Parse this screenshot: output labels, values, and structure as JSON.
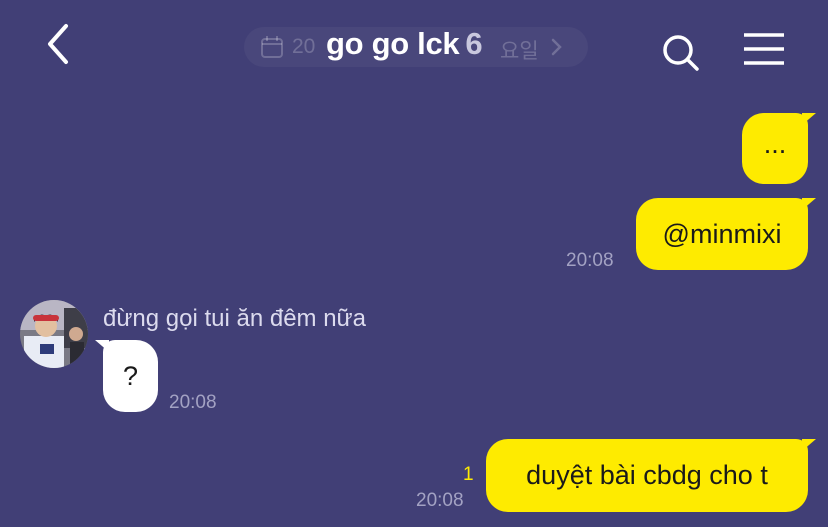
{
  "header": {
    "chat_title": "go go lck",
    "member_count": "6",
    "date_pill_left": "20",
    "date_pill_right": "요일"
  },
  "messages": [
    {
      "direction": "out",
      "text": "..."
    },
    {
      "direction": "out",
      "text": "@minmixi",
      "time": "20:08"
    },
    {
      "direction": "in",
      "sender": "đừng gọi tui ăn đêm nữa",
      "text": "?",
      "time": "20:08"
    },
    {
      "direction": "out",
      "text": "duyệt bài cbdg cho t",
      "time": "20:08",
      "unread": "1"
    }
  ],
  "colors": {
    "background": "#413F76",
    "outgoing_bubble": "#FEEB00",
    "incoming_bubble": "#FFFFFF",
    "timestamp": "#A3A2C3",
    "unread_count": "#FEEB00"
  },
  "icons": [
    "back-arrow-icon",
    "calendar-icon",
    "chevron-right-icon",
    "search-icon",
    "hamburger-menu-icon"
  ]
}
